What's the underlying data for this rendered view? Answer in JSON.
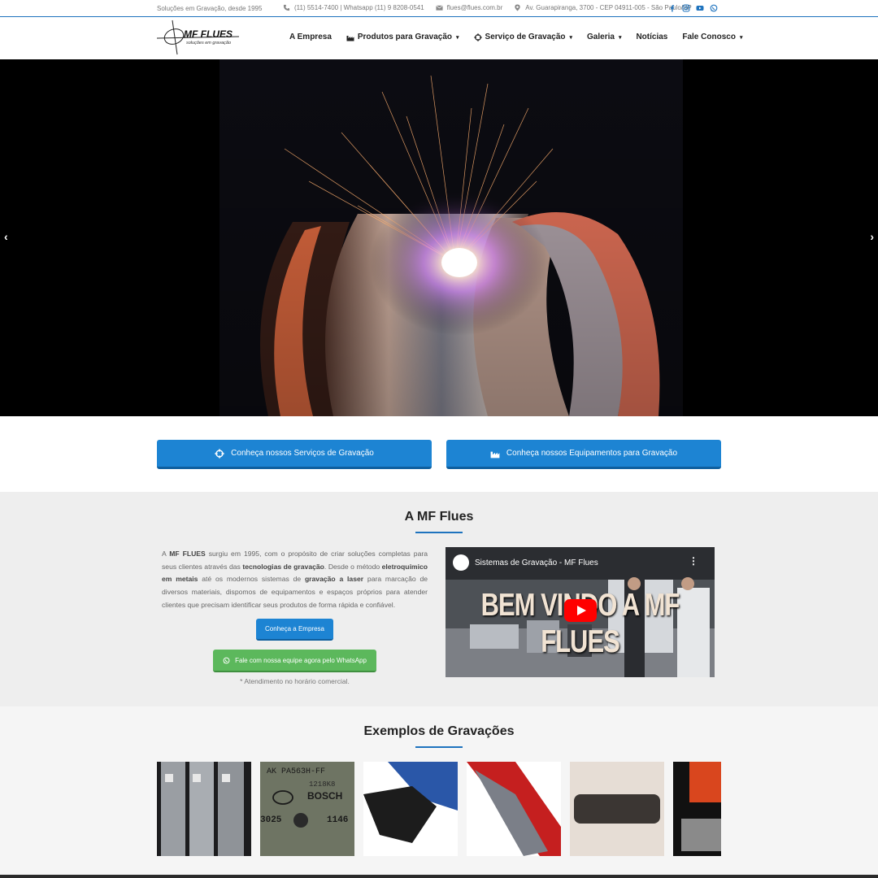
{
  "topbar": {
    "tagline": "Soluções em Gravação, desde 1995",
    "phone": "(11) 5514-7400 | Whatsapp (11) 9 8208-0541",
    "email": "flues@flues.com.br",
    "address": "Av. Guarapiranga, 3700 - CEP 04911-005 - São Paulo/SP",
    "social_icons": [
      "facebook-icon",
      "instagram-icon",
      "youtube-icon",
      "whatsapp-icon"
    ]
  },
  "header": {
    "logo_text": "MF FLUES",
    "logo_sub": "soluções em gravação",
    "nav": [
      {
        "label": "A Empresa"
      },
      {
        "label": "Produtos para Gravação"
      },
      {
        "label": "Serviço de Gravação"
      },
      {
        "label": "Galeria"
      },
      {
        "label": "Notícias"
      },
      {
        "label": "Fale Conosco"
      }
    ]
  },
  "hero": {
    "prev": "‹",
    "next": "›"
  },
  "cta": {
    "services": "Conheça nossos Serviços de Gravação",
    "equipment": "Conheça nossos Equipamentos para Gravação"
  },
  "about": {
    "title": "A MF Flues",
    "text_parts": [
      "A ",
      "MF FLUES",
      " surgiu em 1995, com o propósito de criar soluções completas para seus clientes através das ",
      "tecnologias de gravação",
      ". Desde o método ",
      "eletroquímico em metais",
      " até os modernos sistemas de ",
      "gravação a laser",
      " para marcação de diversos materiais, dispomos de equipamentos e espaços próprios para atender clientes que precisam identificar seus produtos de forma rápida e confiável."
    ],
    "company_button": "Conheça a Empresa",
    "whatsapp_button": "Fale com nossa equipe agora pelo WhatsApp",
    "whatsapp_note": "* Atendimento no horário comercial.",
    "video": {
      "title": "Sistemas de Gravação - MF Flues",
      "banner": "BEM VINDO A MF FLUES"
    }
  },
  "examples": {
    "title": "Exemplos de Gravações",
    "thumb2_lines": [
      "AK PA563H-FF",
      "1218K8",
      "BOSCH",
      "3025",
      "1146"
    ]
  },
  "colors": {
    "accent": "#1e73be",
    "button": "#1d84d3",
    "whatsapp": "#5cb85c"
  }
}
